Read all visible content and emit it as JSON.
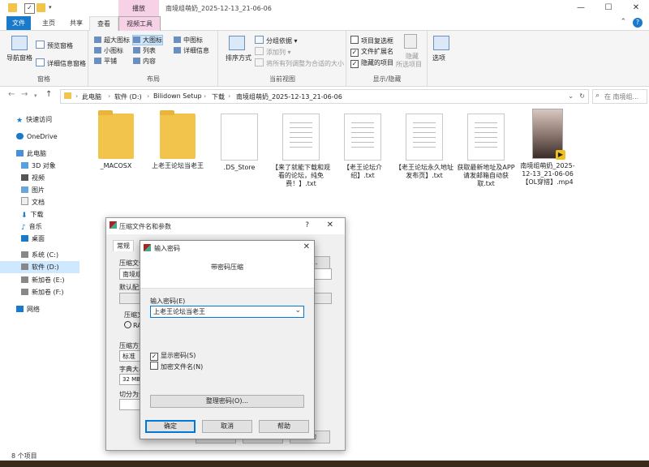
{
  "titlebar": {
    "context_tab": "播放",
    "title": "南境组萌奶_2025-12-13_21-06-06",
    "minimize": "—",
    "maximize": "☐",
    "close": "✕"
  },
  "tabs": [
    "文件",
    "主页",
    "共享",
    "查看",
    "视频工具"
  ],
  "ribbon": {
    "pane_group": {
      "nav_pane": "导航窗格",
      "preview": "预览窗格",
      "details": "详细信息窗格",
      "label": "窗格"
    },
    "layout_group": {
      "items": [
        "超大图标",
        "大图标",
        "中图标",
        "小图标",
        "列表",
        "详细信息",
        "平铺",
        "内容"
      ],
      "label": "布局"
    },
    "view_group": {
      "sort": "排序方式",
      "group_by": "分组依据",
      "add_column": "添加列",
      "fit_columns": "将所有列调整为合适的大小",
      "label": "当前视图"
    },
    "show_group": {
      "item_checkboxes": "项目复选框",
      "file_ext": "文件扩展名",
      "hidden_items": "隐藏的项目",
      "hide_selected": "隐藏",
      "hide_selected_2": "所选项目",
      "label": "显示/隐藏"
    },
    "options": "选项"
  },
  "address": {
    "crumbs": [
      "此电脑",
      "软件 (D:)",
      "Bilidown Setup",
      "下载",
      "南境组萌奶_2025-12-13_21-06-06"
    ],
    "search_placeholder": "在 南境组..."
  },
  "nav": {
    "items": [
      "快速访问",
      "OneDrive",
      "此电脑",
      "3D 对象",
      "视频",
      "图片",
      "文档",
      "下载",
      "音乐",
      "桌面",
      "系统 (C:)",
      "软件 (D:)",
      "新加卷 (E:)",
      "新加卷 (F:)",
      "网络"
    ]
  },
  "files": [
    {
      "name": "_MACOSX",
      "icon": "folder-icon"
    },
    {
      "name": "上老王论坛当老王",
      "icon": "folder-icon"
    },
    {
      "name": ".DS_Store",
      "icon": "file-icon"
    },
    {
      "name": "【来了就能下载和观看的论坛，纯免费！】.txt",
      "icon": "txt-icon"
    },
    {
      "name": "【老王论坛介绍】.txt",
      "icon": "txt-icon"
    },
    {
      "name": "【老王论坛永久地址发布页】.txt",
      "icon": "txt-icon"
    },
    {
      "name": "获取最新地址及APP请发邮箱自动获取.txt",
      "icon": "txt-icon"
    },
    {
      "name": "南境组萌奶_2025-12-13_21-06-06【OL穿搭】.mp4",
      "icon": "video-icon"
    }
  ],
  "status": {
    "count": "8 个项目"
  },
  "compress_dialog": {
    "title": "压缩文件名和参数",
    "help": "?",
    "close": "✕",
    "tab_general": "常规",
    "archive_name_label": "压缩文件",
    "archive_name_value": "南境组",
    "browse": "...",
    "profile_label": "默认配置",
    "format_label": "压缩文",
    "format_rar": "RA",
    "method_label": "压缩方式",
    "method_value": "标准",
    "dict_label": "字典大小",
    "dict_value": "32 MB",
    "split_label": "切分为分",
    "ok": "确定",
    "cancel": "取消",
    "help_btn": "帮助"
  },
  "password_dialog": {
    "title": "输入密码",
    "close": "✕",
    "header": "带密码压缩",
    "input_label": "输入密码(E)",
    "input_value": "上老王论坛当老王",
    "show_password": "显示密码(S)",
    "encrypt_names": "加密文件名(N)",
    "manage": "整理密码(O)...",
    "ok": "确定",
    "cancel": "取消",
    "help": "帮助"
  }
}
